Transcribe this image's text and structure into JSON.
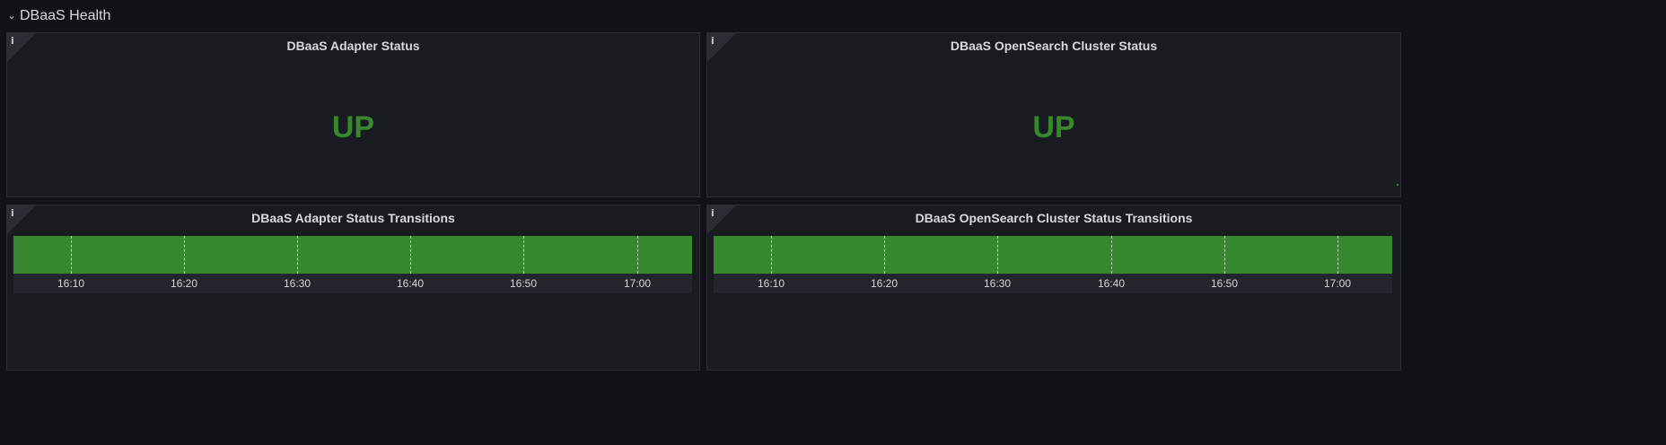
{
  "row": {
    "title": "DBaaS Health"
  },
  "panels": {
    "adapter_status": {
      "title": "DBaaS Adapter Status",
      "value": "UP",
      "info_icon": "info-icon"
    },
    "opensearch_status": {
      "title": "DBaaS OpenSearch Cluster Status",
      "value": "UP",
      "info_icon": "info-icon"
    },
    "adapter_transitions": {
      "title": "DBaaS Adapter Status Transitions",
      "info_icon": "info-icon"
    },
    "opensearch_transitions": {
      "title": "DBaaS OpenSearch Cluster Status Transitions",
      "info_icon": "info-icon"
    }
  },
  "timeline": {
    "ticks": [
      "16:10",
      "16:20",
      "16:30",
      "16:40",
      "16:50",
      "17:00"
    ]
  },
  "colors": {
    "background": "#111217",
    "panel_background": "#181b1f",
    "status_up": "#37872d",
    "text": "#d8d9da"
  }
}
